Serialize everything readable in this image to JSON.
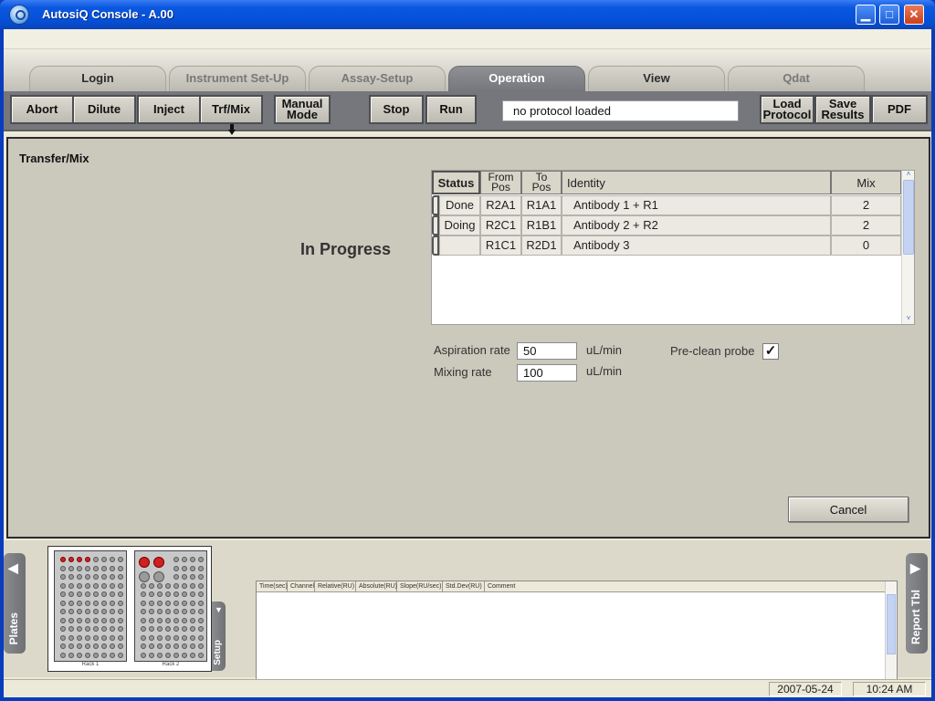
{
  "window": {
    "title": "AutosiQ Console - A.00",
    "minimize_glyph": "▁",
    "maximize_glyph": "□",
    "close_glyph": "✕"
  },
  "tabs": [
    {
      "label": "Login",
      "state": "normal"
    },
    {
      "label": "Instrument Set-Up",
      "state": "dim"
    },
    {
      "label": "Assay-Setup",
      "state": "dim"
    },
    {
      "label": "Operation",
      "state": "active"
    },
    {
      "label": "View",
      "state": "normal"
    },
    {
      "label": "Qdat",
      "state": "dim"
    }
  ],
  "toolbar": {
    "abort": "Abort",
    "dilute": "Dilute",
    "inject": "Inject",
    "trf_mix": "Trf/Mix",
    "manual_mode_line1": "Manual",
    "manual_mode_line2": "Mode",
    "stop": "Stop",
    "run": "Run",
    "protocol_status": "no protocol loaded",
    "load_protocol_line1": "Load",
    "load_protocol_line2": "Protocol",
    "save_results_line1": "Save",
    "save_results_line2": "Results",
    "pdf": "PDF"
  },
  "panel": {
    "title": "Transfer/Mix",
    "state_text": "In Progress"
  },
  "grid": {
    "headers": {
      "status": "Status",
      "from_pos_1": "From",
      "from_pos_2": "Pos",
      "to_pos_1": "To",
      "to_pos_2": "Pos",
      "identity": "Identity",
      "mix": "Mix"
    },
    "rows": [
      {
        "status": "Done",
        "from": "R2A1",
        "to": "R1A1",
        "identity": "Antibody 1 + R1",
        "mix": "2"
      },
      {
        "status": "Doing",
        "from": "R2C1",
        "to": "R1B1",
        "identity": "Antibody 2 + R2",
        "mix": "2"
      },
      {
        "status": "",
        "from": "R1C1",
        "to": "R2D1",
        "identity": "Antibody 3",
        "mix": "0"
      }
    ],
    "scroll_up": "˄",
    "scroll_down": "˅"
  },
  "form": {
    "aspiration_label": "Aspiration rate",
    "aspiration_value": "50",
    "aspiration_unit": "uL/min",
    "mixing_label": "Mixing rate",
    "mixing_value": "100",
    "mixing_unit": "uL/min",
    "preclean_label": "Pre-clean probe",
    "preclean_checked": true,
    "preclean_mark": "✓"
  },
  "cancel_label": "Cancel",
  "side_tabs": {
    "plates": "Plates",
    "setup": "Setup",
    "report": "Report Tbl",
    "plates_arrow": "◀",
    "report_arrow": "▶",
    "setup_arrow": "▼"
  },
  "racks": {
    "rack1_label": "Rack 1",
    "rack2_label": "Rack 2"
  },
  "report": {
    "columns": [
      "Time(sec)",
      "Channel",
      "Relative(RU)",
      "Absolute(RU)",
      "Slope(RU/sec)",
      "Std.Dev(RU)",
      "Comment"
    ]
  },
  "statusbar": {
    "date": "2007-05-24",
    "time": "10:24 AM"
  }
}
